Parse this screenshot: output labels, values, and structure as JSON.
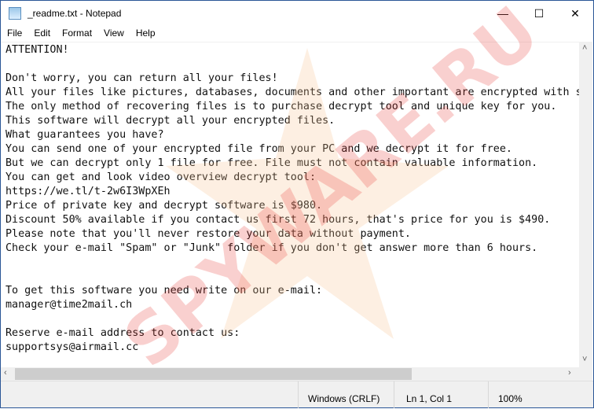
{
  "window": {
    "title": "_readme.txt - Notepad",
    "minimize": "—",
    "maximize": "☐",
    "close": "✕"
  },
  "menu": [
    "File",
    "Edit",
    "Format",
    "View",
    "Help"
  ],
  "content": "ATTENTION!\n\nDon't worry, you can return all your files!\nAll your files like pictures, databases, documents and other important are encrypted with s\nThe only method of recovering files is to purchase decrypt tool and unique key for you.\nThis software will decrypt all your encrypted files.\nWhat guarantees you have?\nYou can send one of your encrypted file from your PC and we decrypt it for free.\nBut we can decrypt only 1 file for free. File must not contain valuable information.\nYou can get and look video overview decrypt tool:\nhttps://we.tl/t-2w6I3WpXEh\nPrice of private key and decrypt software is $980.\nDiscount 50% available if you contact us first 72 hours, that's price for you is $490.\nPlease note that you'll never restore your data without payment.\nCheck your e-mail \"Spam\" or \"Junk\" folder if you don't get answer more than 6 hours.\n\n\nTo get this software you need write on our e-mail:\nmanager@time2mail.ch\n\nReserve e-mail address to contact us:\nsupportsys@airmail.cc\n\nYour personal ID:",
  "status": {
    "line_ending": "Windows (CRLF)",
    "position": "Ln 1, Col 1",
    "zoom": "100%"
  },
  "watermark": "SPYWARE.RU"
}
